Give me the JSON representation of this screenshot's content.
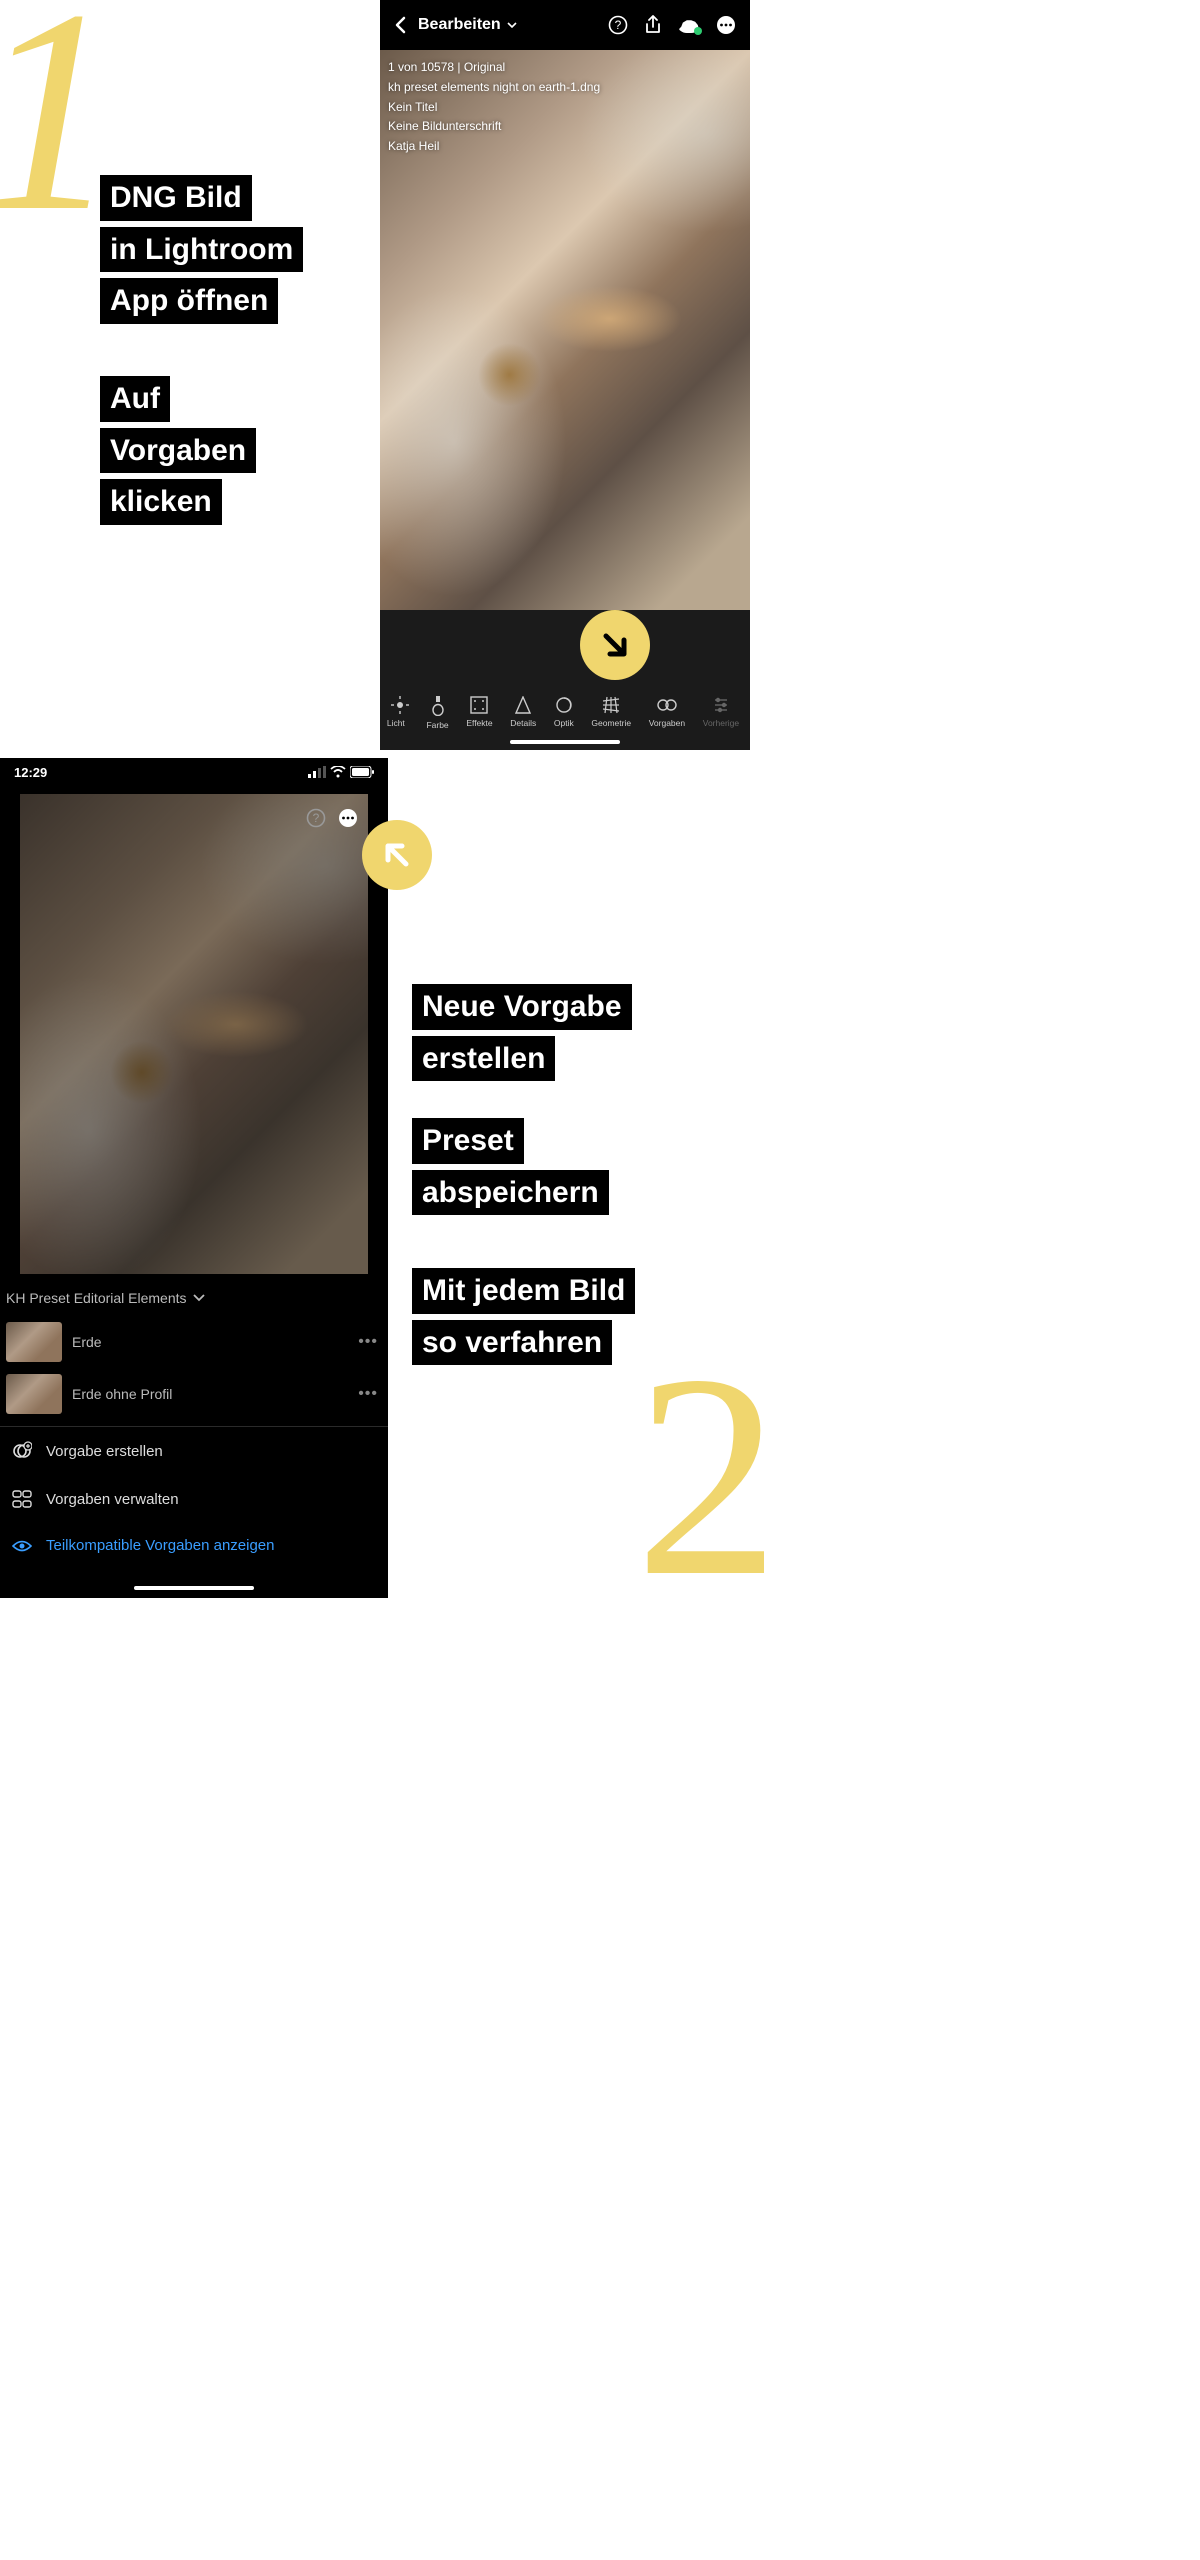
{
  "step1": {
    "lines_a": [
      "DNG Bild",
      "in Lightroom",
      "App öffnen"
    ],
    "lines_b": [
      "Auf",
      "Vorgaben",
      "klicken"
    ]
  },
  "step2": {
    "lines_a": [
      "Neue Vorgabe",
      "erstellen"
    ],
    "lines_b": [
      "Preset",
      "abspeichern"
    ],
    "lines_c": [
      "Mit jedem Bild",
      "so verfahren"
    ]
  },
  "shot1": {
    "header_title": "Bearbeiten",
    "meta": {
      "counter": "1 von 10578 | Original",
      "filename": "kh preset elements night on earth-1.dng",
      "title": "Kein Titel",
      "caption": "Keine Bildunterschrift",
      "author": "Katja Heil"
    },
    "tools": [
      {
        "label": "Licht"
      },
      {
        "label": "Farbe"
      },
      {
        "label": "Effekte"
      },
      {
        "label": "Details"
      },
      {
        "label": "Optik"
      },
      {
        "label": "Geometrie"
      },
      {
        "label": "Vorgaben"
      },
      {
        "label": "Vorherige"
      }
    ]
  },
  "shot2": {
    "time": "12:29",
    "preset_group": "KH Preset Editorial Elements",
    "presets": [
      {
        "label": "Erde"
      },
      {
        "label": "Erde ohne Profil"
      }
    ],
    "menu": {
      "create": "Vorgabe erstellen",
      "manage": "Vorgaben verwalten",
      "show_partial": "Teilkompatible Vorgaben anzeigen"
    }
  }
}
